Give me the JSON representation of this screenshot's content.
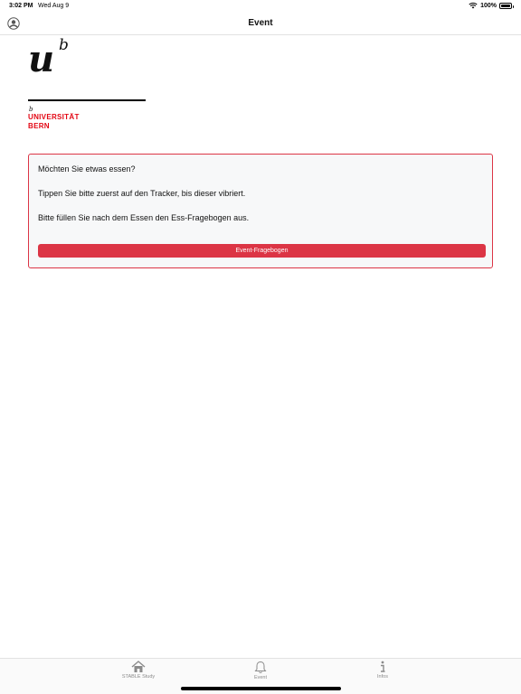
{
  "status_bar": {
    "time": "3:02 PM",
    "date": "Wed Aug 9",
    "battery_percent": "100%",
    "battery_level": 1.0,
    "icons": [
      "wifi-icon",
      "battery-icon"
    ]
  },
  "nav": {
    "title": "Event",
    "left_icon": "profile-icon"
  },
  "logo": {
    "letter_u": "u",
    "letter_b": "b",
    "small_b": "b",
    "line1": "UNIVERSITÄT",
    "line2": "BERN",
    "brand_color": "#e30613"
  },
  "card": {
    "line1": "Möchten Sie etwas essen?",
    "line2": "Tippen Sie bitte zuerst auf den Tracker, bis dieser vibriert.",
    "line3": "Bitte füllen Sie nach dem Essen den Ess-Fragebogen aus.",
    "button_label": "Event-Fragebogen",
    "accent_color": "#dc3545"
  },
  "tab_bar": {
    "items": [
      {
        "label": "STABLE Study",
        "icon": "home-icon"
      },
      {
        "label": "Event",
        "icon": "bell-icon"
      },
      {
        "label": "Infos",
        "icon": "info-icon"
      }
    ]
  }
}
